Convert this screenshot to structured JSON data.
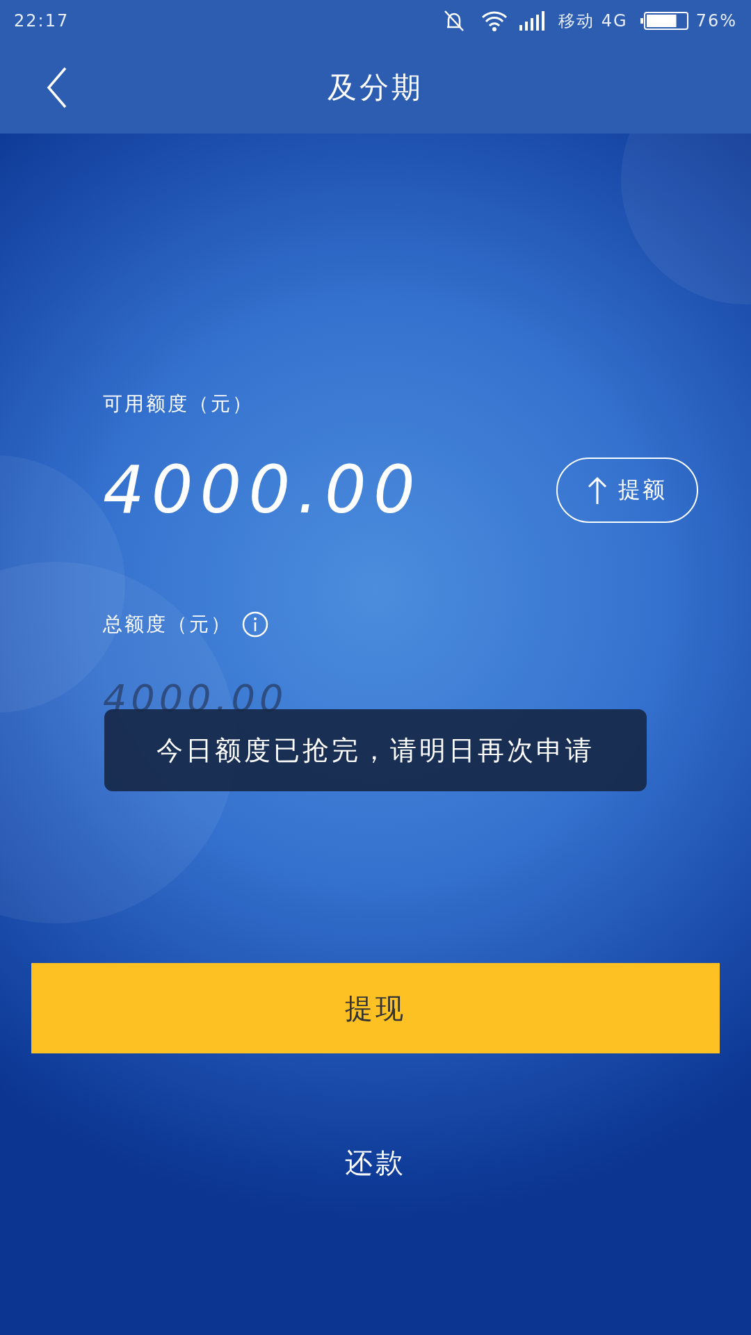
{
  "status_bar": {
    "time": "22:17",
    "carrier": "移动 4G",
    "battery": "76%"
  },
  "header": {
    "title": "及分期"
  },
  "available": {
    "label": "可用额度（元）",
    "amount": "4000.00",
    "raise_button": "提额"
  },
  "total": {
    "label": "总额度（元）",
    "amount": "4000.00"
  },
  "toast": {
    "text": "今日额度已抢完，请明日再次申请"
  },
  "withdraw_button": "提现",
  "repay_link": "还款"
}
